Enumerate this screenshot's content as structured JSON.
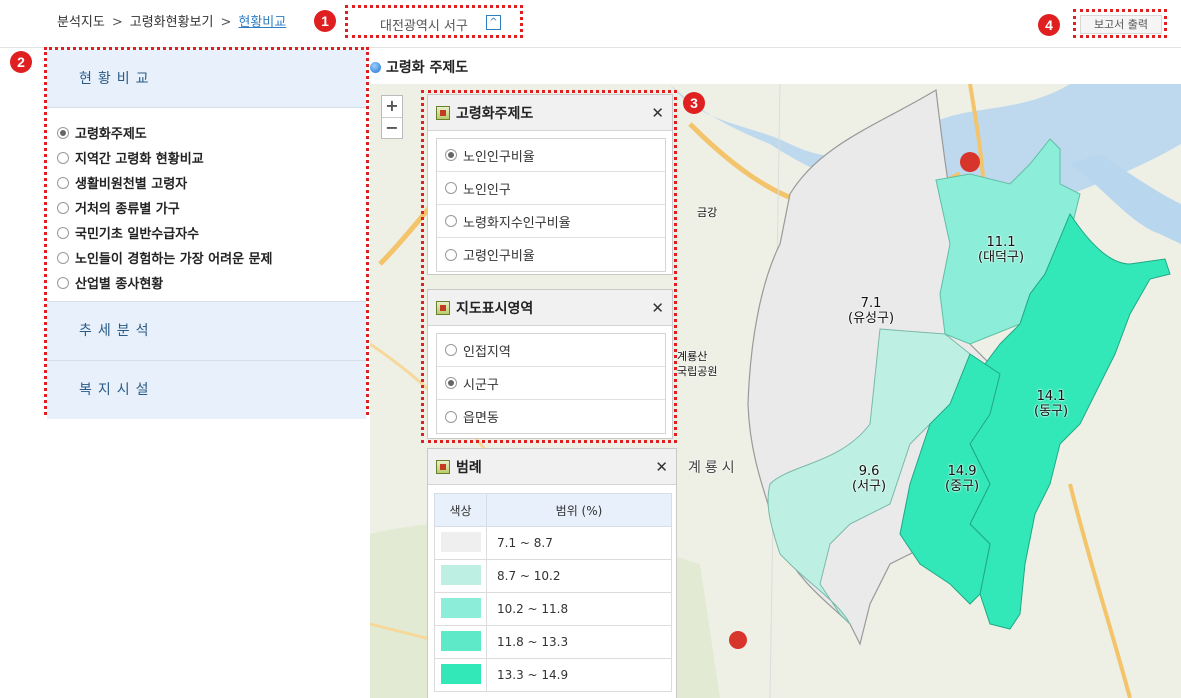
{
  "breadcrumb": {
    "item1": "분석지도",
    "sep1": ">",
    "item2": "고령화현황보기",
    "sep2": ">",
    "item3": "현황비교"
  },
  "region": {
    "value": "대전광역시 서구",
    "caret": "^"
  },
  "report": {
    "label": "보고서 출력"
  },
  "markers": {
    "m1": "1",
    "m2": "2",
    "m3": "3",
    "m4": "4"
  },
  "left_panel": {
    "header": "현황비교",
    "items": [
      {
        "label": "고령화주제도",
        "selected": true
      },
      {
        "label": "지역간 고령화 현황비교",
        "selected": false
      },
      {
        "label": "생활비원천별 고령자",
        "selected": false
      },
      {
        "label": "거처의 종류별 가구",
        "selected": false
      },
      {
        "label": "국민기초 일반수급자수",
        "selected": false
      },
      {
        "label": "노인들이 경험하는 가장 어려운 문제",
        "selected": false
      },
      {
        "label": "산업별 종사현황",
        "selected": false
      }
    ],
    "sections": [
      "추세분석",
      "복지시설"
    ]
  },
  "map_title": "고령화 주제도",
  "zoom": {
    "in": "+",
    "out": "−"
  },
  "theme_panel": {
    "title": "고령화주제도",
    "close": "✕",
    "options": [
      {
        "label": "노인인구비율",
        "selected": true
      },
      {
        "label": "노인인구",
        "selected": false
      },
      {
        "label": "노령화지수인구비율",
        "selected": false
      },
      {
        "label": "고령인구비율",
        "selected": false
      }
    ]
  },
  "area_panel": {
    "title": "지도표시영역",
    "close": "✕",
    "options": [
      {
        "label": "인접지역",
        "selected": false
      },
      {
        "label": "시군구",
        "selected": true
      },
      {
        "label": "읍면동",
        "selected": false
      }
    ]
  },
  "legend_panel": {
    "title": "범례",
    "close": "✕",
    "col_color": "색상",
    "col_range": "범위 (%)",
    "rows": [
      {
        "color": "#efefef",
        "range": "7.1 ~ 8.7"
      },
      {
        "color": "#bdf0e2",
        "range": "8.7 ~ 10.2"
      },
      {
        "color": "#8ceed8",
        "range": "10.2 ~ 11.8"
      },
      {
        "color": "#5ee9c8",
        "range": "11.8 ~ 13.3"
      },
      {
        "color": "#33e8b8",
        "range": "13.3 ~ 14.9"
      }
    ]
  },
  "districts": [
    {
      "value": "7.1",
      "name": "(유성구)",
      "color": "#eaeaea"
    },
    {
      "value": "11.1",
      "name": "(대덕구)",
      "color": "#8ceed8"
    },
    {
      "value": "14.1",
      "name": "(동구)",
      "color": "#33e8b8"
    },
    {
      "value": "9.6",
      "name": "(서구)",
      "color": "#bdf0e2"
    },
    {
      "value": "14.9",
      "name": "(중구)",
      "color": "#33e8b8"
    }
  ],
  "basemap_labels": [
    "금강",
    "계룡산",
    "국립공원",
    "계룡시"
  ]
}
